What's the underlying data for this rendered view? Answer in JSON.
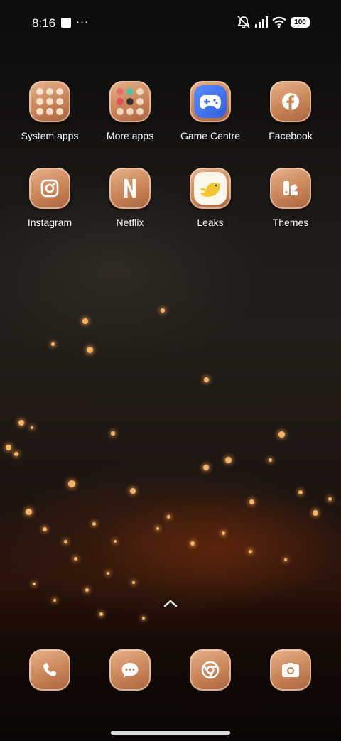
{
  "status_bar": {
    "time": "8:16",
    "more_indicator": "···",
    "battery": "100",
    "icons": [
      "notification-icon",
      "mute-icon",
      "signal-icon",
      "wifi-icon",
      "battery-icon"
    ]
  },
  "home": {
    "apps": [
      {
        "label": "System apps",
        "icon": "folder-icon"
      },
      {
        "label": "More apps",
        "icon": "folder-icon"
      },
      {
        "label": "Game Centre",
        "icon": "gamepad-icon"
      },
      {
        "label": "Facebook",
        "icon": "facebook-icon"
      },
      {
        "label": "Instagram",
        "icon": "instagram-icon"
      },
      {
        "label": "Netflix",
        "icon": "netflix-icon"
      },
      {
        "label": "Leaks",
        "icon": "bird-icon"
      },
      {
        "label": "Themes",
        "icon": "themes-icon"
      }
    ]
  },
  "dock": {
    "apps": [
      {
        "icon": "phone-icon"
      },
      {
        "icon": "messages-icon"
      },
      {
        "icon": "chrome-icon"
      },
      {
        "icon": "camera-icon"
      }
    ]
  },
  "colors": {
    "icon_tile": "#c98458",
    "icon_tile_light": "#e8b48e",
    "accent_blue": "#3f6ef0",
    "wallpaper_glow": "#f3b46a"
  }
}
